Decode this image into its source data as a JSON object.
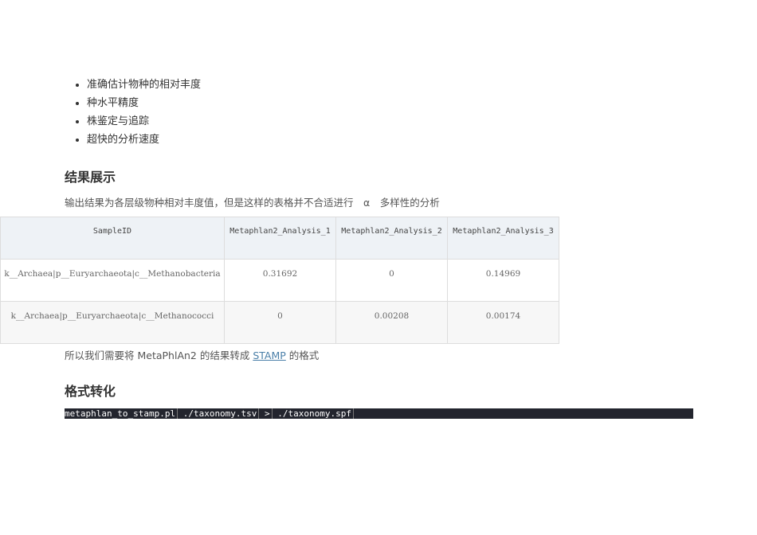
{
  "bullets": [
    "准确估计物种的相对丰度",
    "种水平精度",
    "株鉴定与追踪",
    "超快的分析速度"
  ],
  "h_results": "结果展示",
  "p_results": "输出结果为各层级物种相对丰度值，但是这样的表格并不合适进行　α　多样性的分析",
  "table": {
    "headers": [
      "SampleID",
      "Metaphlan2_Analysis_1",
      "Metaphlan2_Analysis_2",
      "Metaphlan2_Analysis_3"
    ],
    "rows": [
      [
        "k__Archaea|p__Euryarchaeota|c__Methanobacteria",
        "0.31692",
        "0",
        "0.14969"
      ],
      [
        "k__Archaea|p__Euryarchaeota|c__Methanococci",
        "0",
        "0.00208",
        "0.00174"
      ]
    ]
  },
  "p_convert_pre": "所以我们需要将 MetaPhlAn2 的结果转成 ",
  "p_convert_link": "STAMP",
  "p_convert_post": " 的格式",
  "h_format": "格式转化",
  "code": [
    "metaphlan_to_stamp.pl",
    "./taxonomy.tsv",
    ">",
    "./taxonomy.spf"
  ]
}
